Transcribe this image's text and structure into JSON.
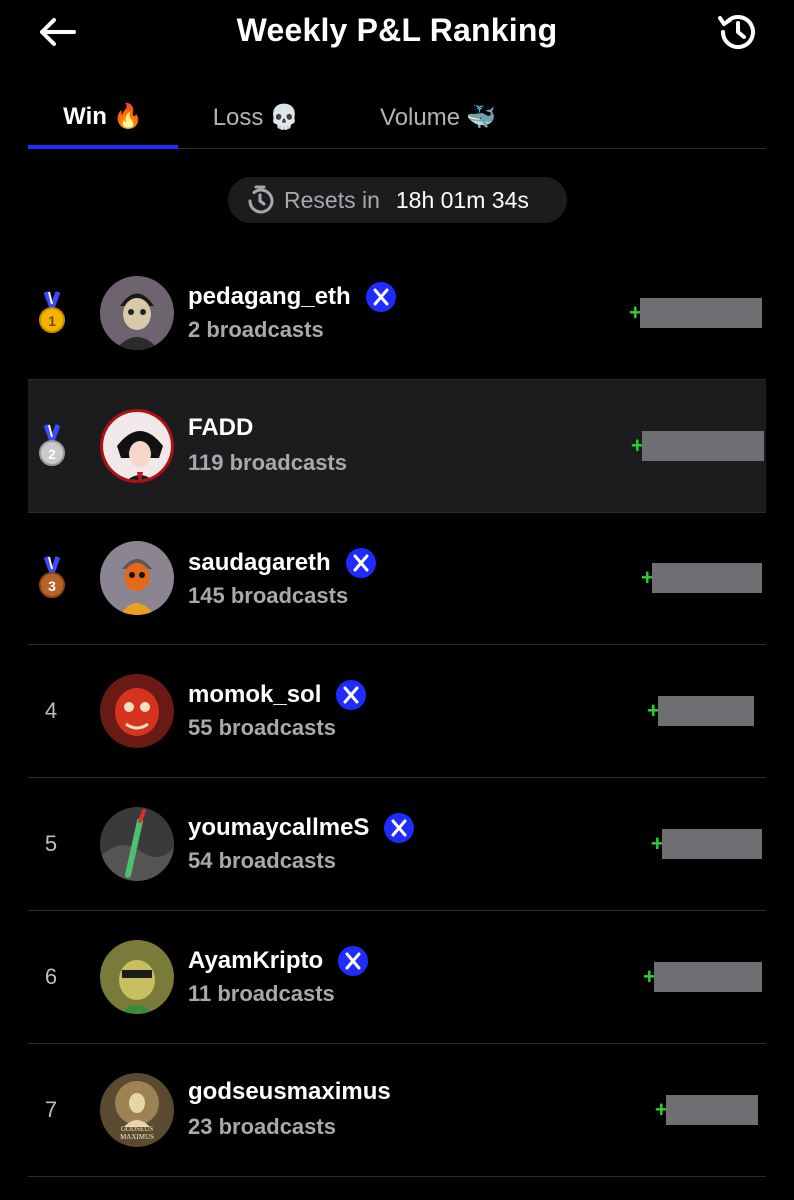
{
  "header": {
    "title": "Weekly P&L Ranking",
    "back_icon": "arrow-left-icon",
    "history_icon": "history-clock-icon"
  },
  "tabs": [
    {
      "label": "Win",
      "emoji": "🔥",
      "active": true
    },
    {
      "label": "Loss",
      "emoji": "💀",
      "active": false
    },
    {
      "label": "Volume",
      "emoji": "🐳",
      "active": false
    }
  ],
  "reset": {
    "label": "Resets in",
    "time": "18h 01m 34s",
    "icon": "timer-icon"
  },
  "colors": {
    "background": "#000000",
    "accent_blue": "#1f2bff",
    "profit_green": "#2bd22b",
    "row_highlight": "#1c1c1e",
    "muted_text": "#a8a8ad"
  },
  "rankings": [
    {
      "rank": "1",
      "medal": "gold-medal-icon",
      "username": "pedagang_eth",
      "verified_x": true,
      "broadcasts": "2 broadcasts",
      "pnl_visible": "+$",
      "pnl_redacted": true
    },
    {
      "rank": "2",
      "medal": "silver-medal-icon",
      "username": "FADD",
      "verified_x": false,
      "broadcasts": "119 broadcasts",
      "pnl_visible": "+$",
      "pnl_redacted": true,
      "highlighted": true
    },
    {
      "rank": "3",
      "medal": "bronze-medal-icon",
      "username": "saudagareth",
      "verified_x": true,
      "broadcasts": "145 broadcasts",
      "pnl_visible": "+$",
      "pnl_redacted": true
    },
    {
      "rank": "4",
      "username": "momok_sol",
      "verified_x": true,
      "broadcasts": "55 broadcasts",
      "pnl_visible": "+$",
      "pnl_redacted": true
    },
    {
      "rank": "5",
      "username": "youmaycallmeS",
      "verified_x": true,
      "broadcasts": "54 broadcasts",
      "pnl_visible": "+$",
      "pnl_redacted": true
    },
    {
      "rank": "6",
      "username": "AyamKripto",
      "verified_x": true,
      "broadcasts": "11 broadcasts",
      "pnl_visible": "+$",
      "pnl_redacted": true
    },
    {
      "rank": "7",
      "username": "godseusmaximus",
      "verified_x": false,
      "broadcasts": "23 broadcasts",
      "pnl_visible": "+$",
      "pnl_redacted": true,
      "avatar_text": "GODSEUS MAXIMUS"
    }
  ]
}
